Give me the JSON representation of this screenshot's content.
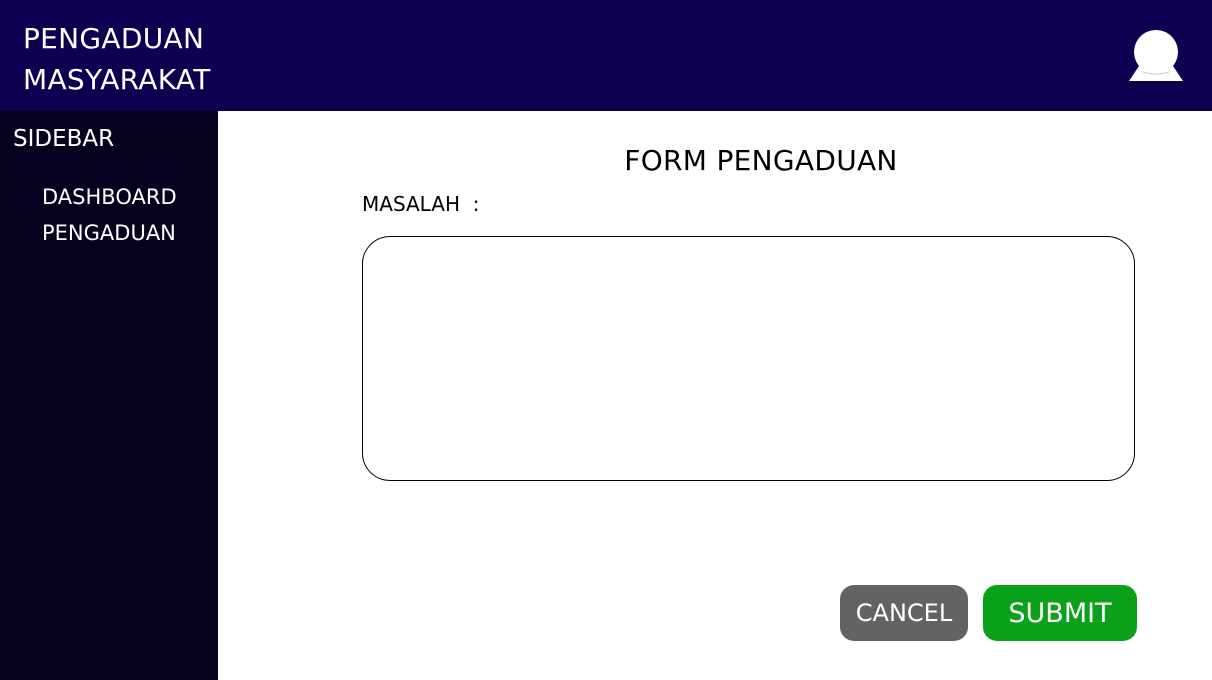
{
  "header": {
    "app_title": "PENGADUAN\nMASYARAKAT",
    "background_color": "#0d0050",
    "avatar_icon": "user-avatar-icon"
  },
  "sidebar": {
    "title": "SIDEBAR",
    "background_color": "#07001e",
    "items": [
      {
        "label": "DASHBOARD"
      },
      {
        "label": "PENGADUAN"
      }
    ]
  },
  "form": {
    "title": "FORM PENGADUAN",
    "masalah_label": "MASALAH  :",
    "masalah_value": "",
    "cancel_label": "CANCEL",
    "submit_label": "SUBMIT",
    "cancel_color": "#636363",
    "submit_color": "#0ba11b"
  }
}
